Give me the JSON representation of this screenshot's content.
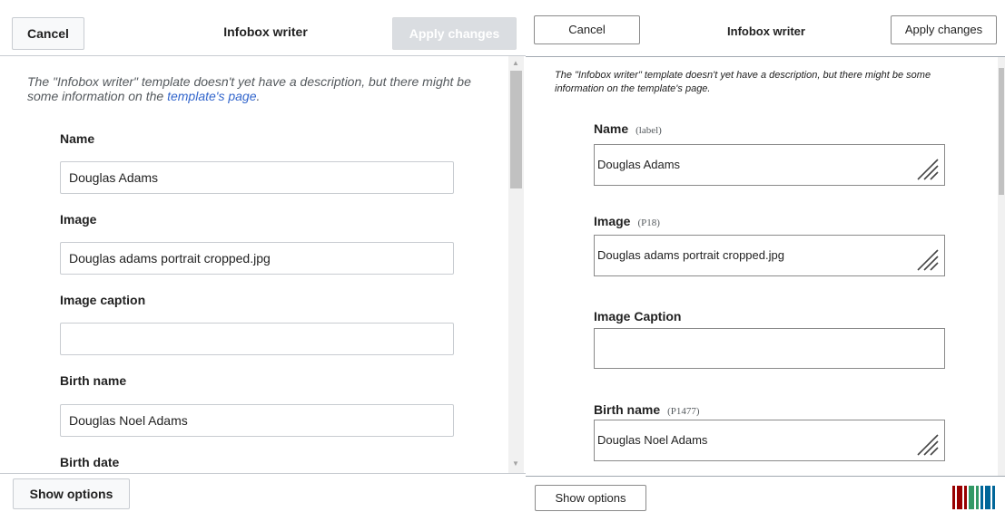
{
  "left": {
    "header": {
      "cancel_label": "Cancel",
      "title": "Infobox writer",
      "apply_label": "Apply changes"
    },
    "description": {
      "text": "The \"Infobox writer\" template doesn't yet have a description, but there might be some information on the ",
      "link_text": "template's page",
      "end": "."
    },
    "fields": [
      {
        "label": "Name",
        "value": ""
      },
      {
        "label": "Image",
        "value": ""
      },
      {
        "label": "Image caption",
        "value": ""
      },
      {
        "label": "Birth name",
        "value": ""
      },
      {
        "label": "Birth date"
      }
    ],
    "values": [
      "Douglas Adams",
      "Douglas adams portrait cropped.jpg",
      "",
      "Douglas Noel Adams"
    ],
    "footer": {
      "show_options_label": "Show options"
    }
  },
  "right": {
    "header": {
      "cancel_label": "Cancel",
      "title": "Infobox writer",
      "apply_label": "Apply changes"
    },
    "description": {
      "text": "The \"Infobox writer\" template doesn't yet have a description, but there might be some information on the template's page."
    },
    "fields": [
      {
        "label": "Name",
        "property": "(label)",
        "value": "Douglas Adams"
      },
      {
        "label": "Image",
        "property": "(P18)",
        "value": "Douglas adams portrait cropped.jpg"
      },
      {
        "label": "Image Caption",
        "property": "",
        "value": ""
      },
      {
        "label": "Birth name",
        "property": "(P1477)",
        "value": "Douglas Noel Adams"
      }
    ],
    "footer": {
      "show_options_label": "Show options"
    }
  },
  "colors": {
    "link": "#3366cc",
    "apply_disabled_bg": "#dadde1",
    "border": "#c8ccd1"
  },
  "icons": [
    "chevron-up-icon",
    "chevron-down-icon",
    "resize-grip-icon",
    "wikidata-logo"
  ]
}
